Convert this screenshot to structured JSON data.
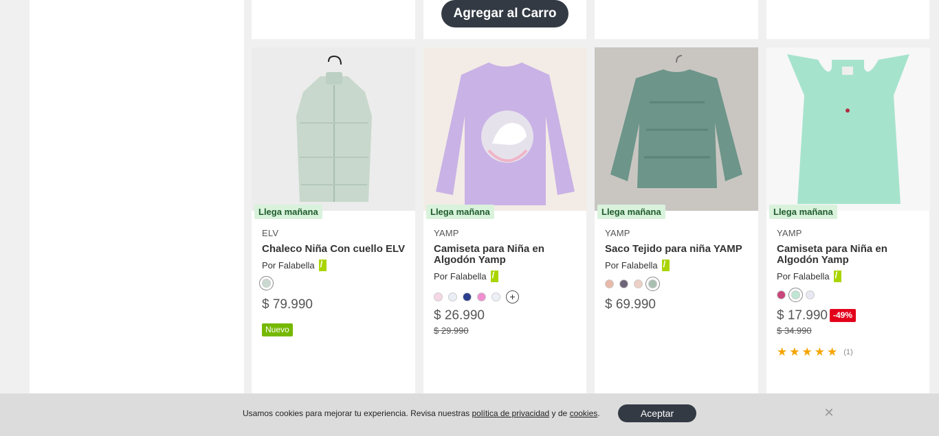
{
  "top_row": {
    "add_to_cart_label": "Agregar al Carro"
  },
  "products": [
    {
      "delivery_badge": "Llega mañana",
      "brand": "ELV",
      "title": "Chaleco Niña Con cuello ELV",
      "seller": "Por Falabella",
      "swatches": [
        "#c9d9cf"
      ],
      "price": "$ 79.990",
      "badge": "Nuevo"
    },
    {
      "delivery_badge": "Llega mañana",
      "brand": "YAMP",
      "title": "Camiseta para Niña en Algodón Yamp",
      "seller": "Por Falabella",
      "swatches": [
        "#f6d7e6",
        "#e9eef5",
        "#2c3e8c",
        "#ef8fcf",
        "#eef0f7"
      ],
      "more_colors": "+",
      "price": "$ 26.990",
      "old_price": "$ 29.990"
    },
    {
      "delivery_badge": "Llega mañana",
      "brand": "YAMP",
      "title": "Saco Tejido para niña YAMP",
      "seller": "Por Falabella",
      "swatches": [
        "#e8b9a8",
        "#6e6477",
        "#edd0c5",
        "#a9bfb2"
      ],
      "price": "$ 69.990"
    },
    {
      "delivery_badge": "Llega mañana",
      "brand": "YAMP",
      "title": "Camiseta para Niña en Algodón Yamp",
      "seller": "Por Falabella",
      "swatches": [
        "#c8477a",
        "#bfe6d3",
        "#e8e8f3"
      ],
      "price": "$ 17.990",
      "discount": "-49%",
      "old_price": "$ 34.990",
      "rating": 5,
      "rating_count": "(1)"
    }
  ],
  "cookie_banner": {
    "text_before": "Usamos cookies para mejorar tu experiencia. Revisa nuestras ",
    "privacy_link": "política de privacidad",
    "text_middle": " y de ",
    "cookies_link": "cookies",
    "text_after": ".",
    "accept_label": "Aceptar",
    "close_icon": "close-icon"
  },
  "colors": {
    "dark_button": "#333a44",
    "delivery_bg": "#d9f2dc",
    "discount": "#e3001b",
    "new_badge": "#75b800",
    "star": "#f5a400"
  }
}
